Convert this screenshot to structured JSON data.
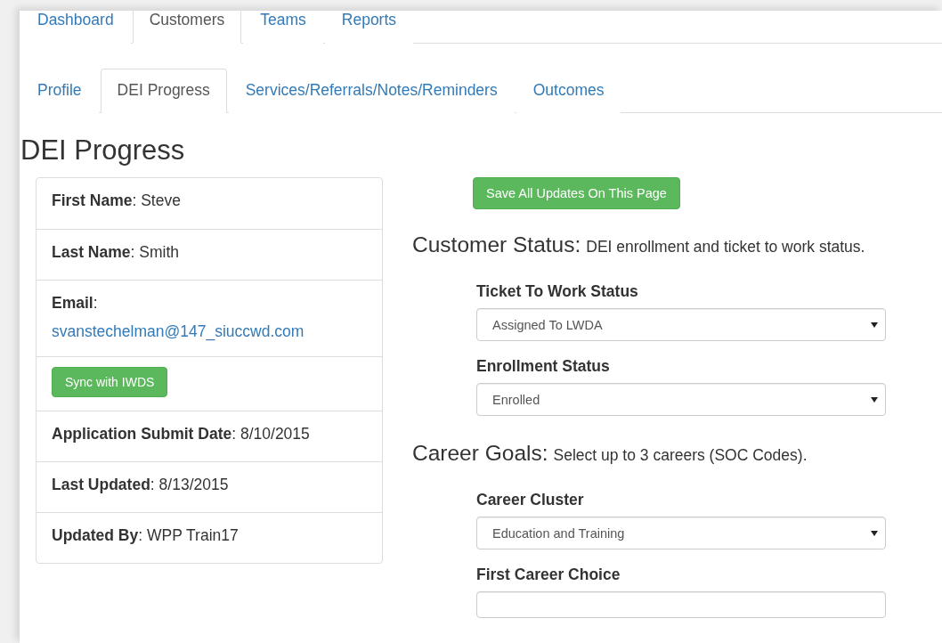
{
  "nav_tabs": [
    {
      "label": "Dashboard",
      "selected": false
    },
    {
      "label": "Customers",
      "selected": true
    },
    {
      "label": "Teams",
      "selected": false
    },
    {
      "label": "Reports",
      "selected": false
    }
  ],
  "sub_tabs": [
    {
      "label": "Profile",
      "selected": false
    },
    {
      "label": "DEI Progress",
      "selected": true
    },
    {
      "label": "Services/Referrals/Notes/Reminders",
      "selected": false
    },
    {
      "label": "Outcomes",
      "selected": false
    }
  ],
  "page_title": "DEI Progress",
  "profile_rows": [
    {
      "kind": "field",
      "text": "**First Name**: Steve"
    },
    {
      "kind": "field",
      "text": "**Last Name**: Smith"
    },
    {
      "kind": "email",
      "text": "**Email**:",
      "link": "svanstechelman@147_siuccwd.com"
    },
    {
      "kind": "button",
      "label": "Sync with IWDS"
    },
    {
      "kind": "field",
      "text": "**Application Submit Date**: 8/10/2015"
    },
    {
      "kind": "field",
      "text": "**Last Updated**: 8/13/2015"
    },
    {
      "kind": "field",
      "text": "**Updated By**: WPP Train17"
    }
  ],
  "save_button": "Save All Updates On This Page",
  "sections": [
    {
      "title": "Customer Status:",
      "subtitle": "DEI enrollment and ticket to work status.",
      "fields": [
        {
          "label": "Ticket To Work Status",
          "value": "Assigned To LWDA"
        },
        {
          "label": "Enrollment Status",
          "value": "Enrolled"
        }
      ]
    },
    {
      "title": "Career Goals:",
      "subtitle": "Select up to 3 careers (SOC Codes).",
      "fields": [
        {
          "label": "Career Cluster",
          "value": "Education and Training"
        },
        {
          "label": "First Career Choice"
        }
      ]
    }
  ]
}
